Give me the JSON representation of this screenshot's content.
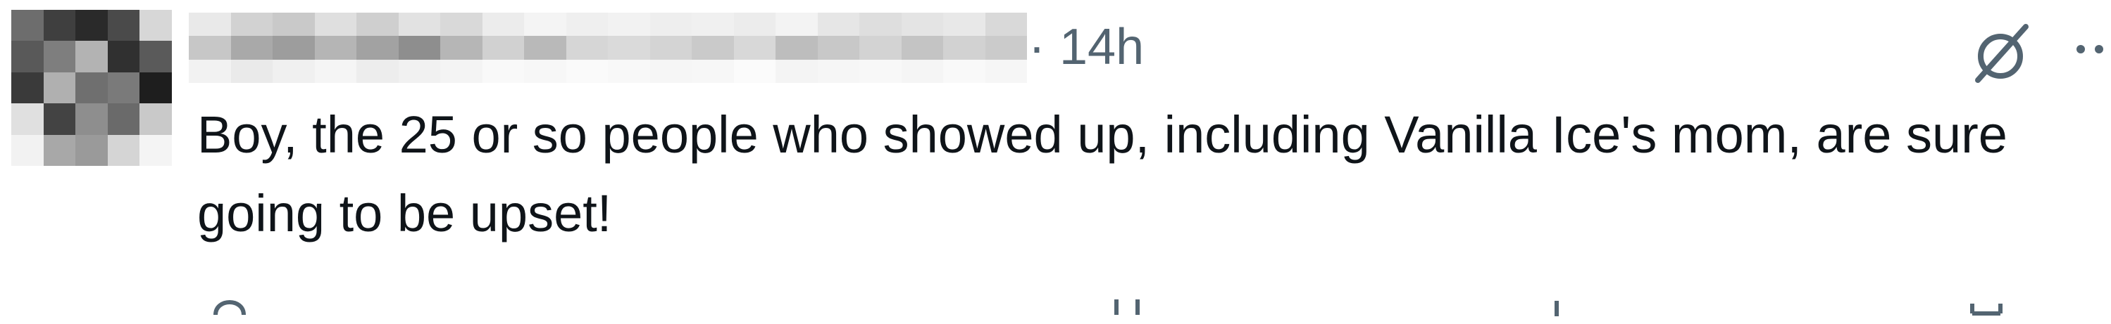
{
  "post": {
    "separator": "·",
    "timestamp": "14h",
    "text": "Boy, the 25 or so people who showed up, including Vanilla Ice's mom, are sure going to be upset!"
  },
  "icons": {
    "grok": "grok-icon",
    "more": "more-icon",
    "avatar": "avatar-blurred",
    "username": "username-blurred"
  },
  "colors": {
    "text": "#0f1419",
    "secondary": "#536471"
  }
}
